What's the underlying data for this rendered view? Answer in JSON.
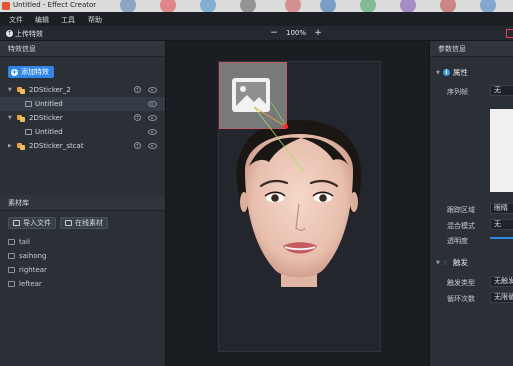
{
  "window": {
    "title": "Untitled - Effect Creator"
  },
  "menu": [
    "文件",
    "编辑",
    "工具",
    "帮助"
  ],
  "toolbar": {
    "upload_label": "上传特效",
    "zoom": "100%",
    "zoom_out": "−",
    "zoom_in": "+"
  },
  "effects_panel": {
    "title": "特效信息",
    "add_label": "添加特效",
    "tree": [
      {
        "label": "2DSticker_2",
        "level": 0,
        "expanded": true,
        "selected": false
      },
      {
        "label": "Untitled",
        "level": 1,
        "selected": true
      },
      {
        "label": "2DSticker",
        "level": 0,
        "expanded": true,
        "selected": false
      },
      {
        "label": "Untitled",
        "level": 1,
        "selected": false
      },
      {
        "label": "2DSticker_stcat",
        "level": 0,
        "expanded": false,
        "selected": false
      }
    ]
  },
  "assets_panel": {
    "title": "素材库",
    "import_label": "导入文件",
    "online_label": "在线素材",
    "items": [
      "tail",
      "saihong",
      "rightear",
      "leftear"
    ]
  },
  "params_panel": {
    "title": "参数信息",
    "attributes_section": "属性",
    "sequence_label": "序列帧",
    "sequence_value": "无",
    "track_label": "跟踪区域",
    "track_value": "眼睛",
    "blend_label": "混合模式",
    "blend_value": "无",
    "opacity_label": "透明度",
    "trigger_section": "触发",
    "trigger_type_label": "触发类型",
    "trigger_type_value": "无触发",
    "loop_label": "循环次数",
    "loop_value": "无限循环"
  },
  "colors": {
    "accent": "#2f86e6",
    "panel_bg": "#2b2f36",
    "canvas_bg": "#1a1d21",
    "sticker_icon": "#e9a23b",
    "anchor": "#ff2a2a"
  }
}
